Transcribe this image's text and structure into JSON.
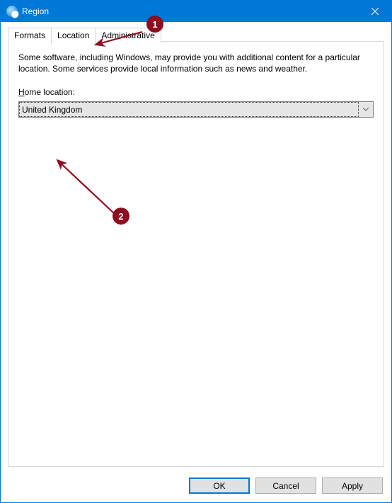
{
  "window": {
    "title": "Region"
  },
  "tabs": {
    "formats": "Formats",
    "location": "Location",
    "administrative": "Administrative",
    "active": "Location"
  },
  "body": {
    "description": "Some software, including Windows, may provide you with additional content for a particular location. Some services provide local information such as news and weather.",
    "home_label_underlined_letter": "H",
    "home_label_rest": "ome location:"
  },
  "dropdown": {
    "selected": "United Kingdom"
  },
  "buttons": {
    "ok": "OK",
    "cancel": "Cancel",
    "apply": "Apply"
  },
  "annotations": {
    "badge1": "1",
    "badge2": "2",
    "color": "#8e0d1e"
  }
}
